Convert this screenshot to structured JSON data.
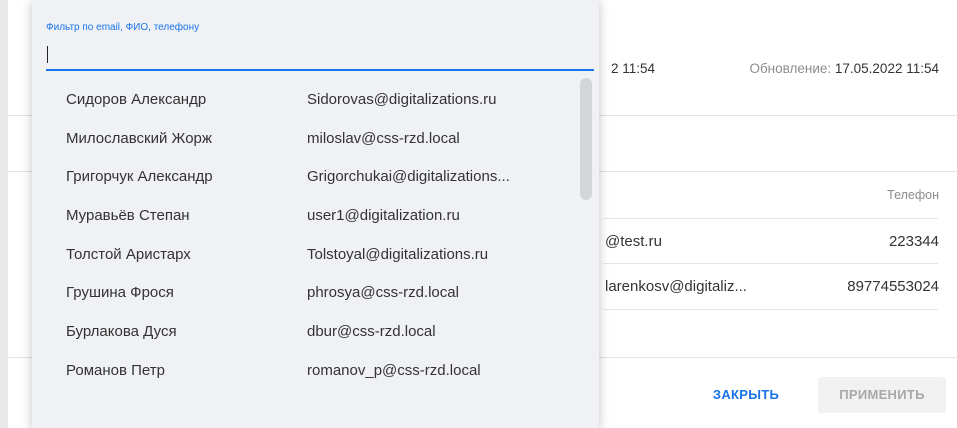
{
  "record": {
    "created": "2 11:54",
    "updated_label": "Обновление: ",
    "updated_value": "17.05.2022 11:54"
  },
  "table": {
    "phone_header": "Телефон",
    "rows": [
      {
        "email": "@test.ru",
        "phone": "223344"
      },
      {
        "email": "larenkosv@digitaliz...",
        "phone": "89774553024"
      }
    ]
  },
  "buttons": {
    "close": "ЗАКРЫТЬ",
    "apply": "ПРИМЕНИТЬ"
  },
  "filter": {
    "label": "Фильтр по email, ФИО, телефону",
    "value": ""
  },
  "options": [
    {
      "name": "Сидоров Александр",
      "email": "Sidorovas@digitalizations.ru"
    },
    {
      "name": "Милославский Жорж",
      "email": "miloslav@css-rzd.local"
    },
    {
      "name": "Григорчук Александр",
      "email": "Grigorchukai@digitalizations..."
    },
    {
      "name": "Муравьёв Степан",
      "email": "user1@digitalization.ru"
    },
    {
      "name": "Толстой Аристарх",
      "email": "Tolstoyal@digitalizations.ru"
    },
    {
      "name": "Грушина Фрося",
      "email": "phrosya@css-rzd.local"
    },
    {
      "name": "Бурлакова Дуся",
      "email": "dbur@css-rzd.local"
    },
    {
      "name": "Романов Петр",
      "email": "romanov_p@css-rzd.local"
    }
  ]
}
